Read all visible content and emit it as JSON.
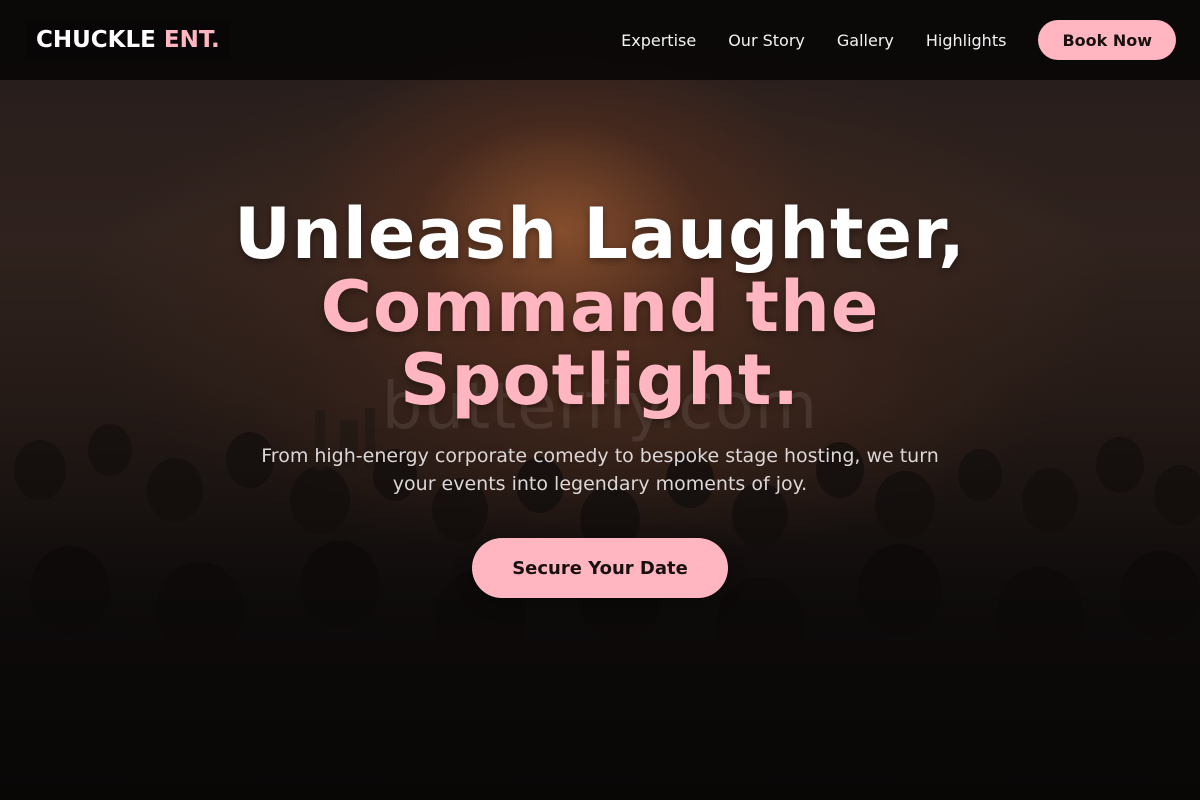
{
  "brand": {
    "name_main": "CHUCKLE",
    "name_accent": "ENT."
  },
  "nav": {
    "links": [
      "Expertise",
      "Our Story",
      "Gallery",
      "Highlights"
    ],
    "cta_label": "Book Now"
  },
  "hero": {
    "headline_line1": "Unleash Laughter,",
    "headline_line2": "Command the",
    "headline_line3": "Spotlight.",
    "subtext": "From high-energy corporate comedy to bespoke stage hosting, we turn your events into legendary moments of joy.",
    "cta_label": "Secure Your Date",
    "watermark": "butterfly.com"
  },
  "colors": {
    "accent": "#ffb6c1",
    "nav_bg": "#080606",
    "text_light": "#ffffff"
  }
}
